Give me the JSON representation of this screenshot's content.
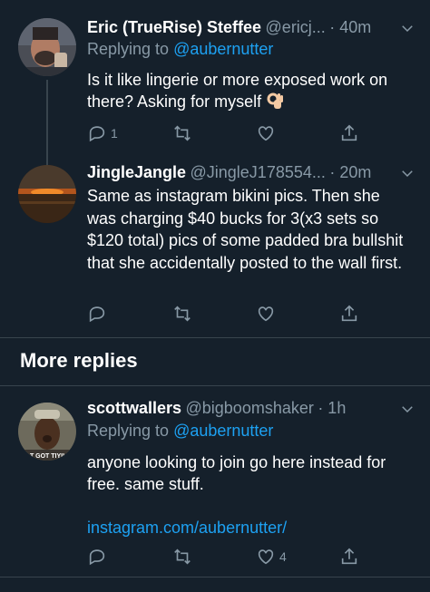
{
  "tweets": [
    {
      "name": "Eric (TrueRise) Steffee",
      "handle": "@ericj...",
      "time": "· 40m",
      "replying_prefix": "Replying to ",
      "replying_to": "@aubernutter",
      "text_line1": "Is it like lingerie or more exposed work on",
      "text_line2": "there? Asking for myself",
      "emoji": "ok-hand-emoji",
      "reply_count": "1",
      "retweet_count": "",
      "like_count": ""
    },
    {
      "name": "JingleJangle",
      "handle": "@JingleJ178554...",
      "time": "· 20m",
      "text": "Same as instagram bikini pics. Then she was charging $40 bucks for 3(x3 sets so $120 total) pics of some padded bra bullshit that she accidentally posted to the wall first.",
      "reply_count": "",
      "retweet_count": "",
      "like_count": ""
    },
    {
      "name": "scottwallers",
      "handle": "@bigboomshaker",
      "time": "· 1h",
      "replying_prefix": "Replying to ",
      "replying_to": "@aubernutter",
      "text": "anyone looking to join go here instead for free. same stuff.",
      "link": "instagram.com/aubernutter/",
      "reply_count": "",
      "retweet_count": "",
      "like_count": "4"
    }
  ],
  "section": {
    "title": "More replies"
  },
  "avatar_caption": "T GOT TIYII",
  "colors": {
    "background": "#15202b",
    "secondary_text": "#8899a6",
    "accent": "#1da1f2",
    "divider": "#38444d"
  },
  "icons": [
    "reply-icon",
    "retweet-icon",
    "like-icon",
    "share-icon",
    "chevron-down-icon"
  ]
}
